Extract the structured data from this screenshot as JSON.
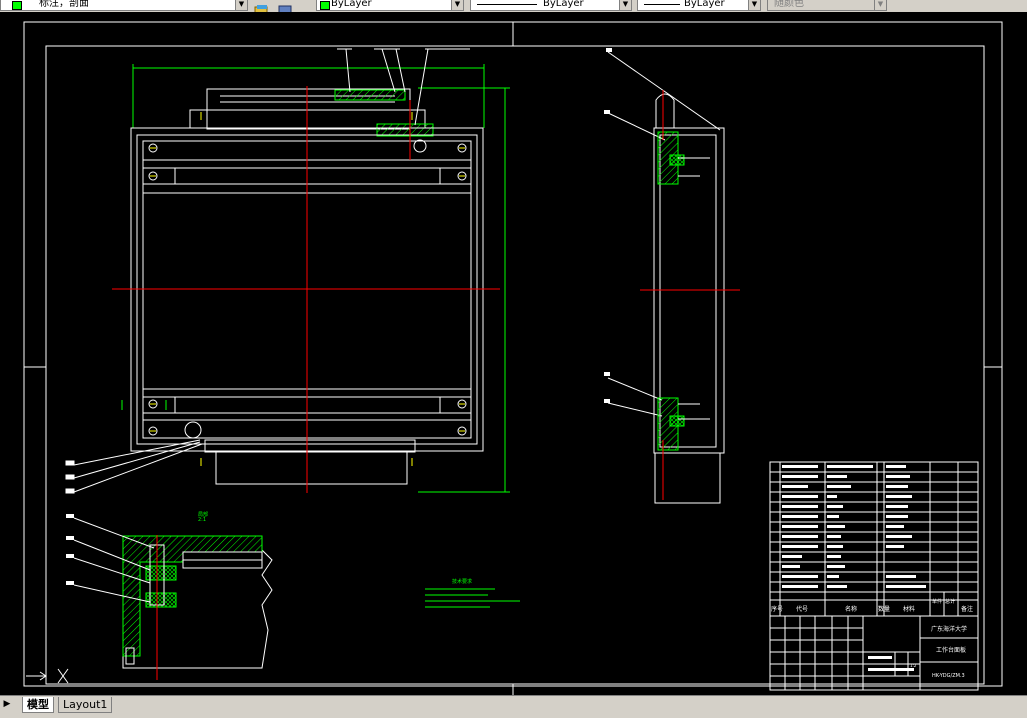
{
  "toolbar": {
    "layer_name": "标注，剖面",
    "color_value": "ByLayer",
    "linetype_value": "ByLayer",
    "lineweight_value": "ByLayer",
    "plotstyle_value": "随颜色"
  },
  "drawing": {
    "technical_requirements_title": "技术要求",
    "detail_label": "局部",
    "detail_scale": "2:1",
    "title_block": {
      "school": "广东海洋大学",
      "drawing_name": "工作台面板",
      "drawing_number": "HK-YDG/ZM.3",
      "scale": "1:2"
    },
    "bom_headers": [
      "序号",
      "代号",
      "名称",
      "数量",
      "材料",
      "单件",
      "总计",
      "备注"
    ]
  },
  "tabs": {
    "model": "模型",
    "layout1": "Layout1"
  },
  "colors": {
    "background": "#000000",
    "outline": "#ffffff",
    "center_line": "#ff0000",
    "dimension": "#00ff00",
    "hatch": "#00ff00"
  }
}
